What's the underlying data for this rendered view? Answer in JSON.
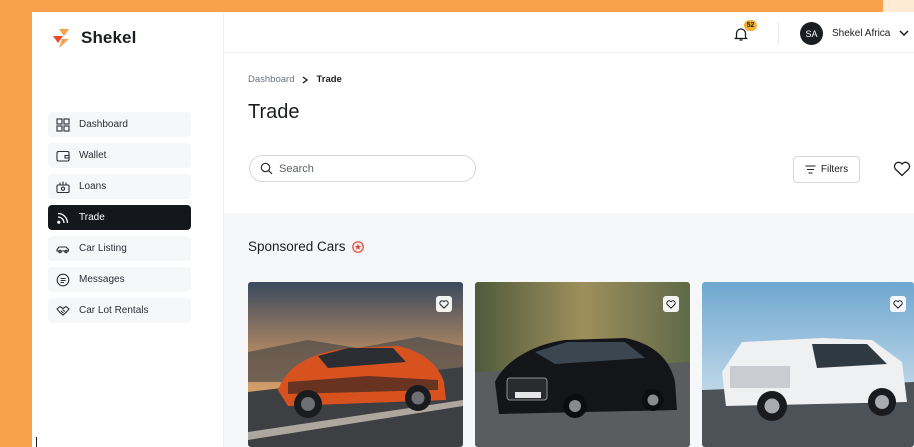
{
  "app": {
    "name": "Shekel"
  },
  "sidebar": {
    "items": [
      {
        "label": "Dashboard",
        "icon": "grid-icon",
        "active": false
      },
      {
        "label": "Wallet",
        "icon": "wallet-icon",
        "active": false
      },
      {
        "label": "Loans",
        "icon": "loans-icon",
        "active": false
      },
      {
        "label": "Trade",
        "icon": "rss-icon",
        "active": true
      },
      {
        "label": "Car Listing",
        "icon": "car-icon",
        "active": false
      },
      {
        "label": "Messages",
        "icon": "message-icon",
        "active": false
      },
      {
        "label": "Car Lot Rentals",
        "icon": "handshake-icon",
        "active": false
      }
    ]
  },
  "header": {
    "notifications": {
      "count": "52",
      "icon": "bell-icon"
    },
    "user": {
      "initials": "SA",
      "name": "Shekel Africa"
    }
  },
  "breadcrumb": {
    "root": "Dashboard",
    "current": "Trade"
  },
  "page": {
    "title": "Trade"
  },
  "search": {
    "placeholder": "Search",
    "value": ""
  },
  "toolbar": {
    "filters_label": "Filters"
  },
  "sponsored": {
    "title": "Sponsored Cars",
    "cars": [
      {
        "image": "orange-sedan",
        "icon": "heart-icon"
      },
      {
        "image": "black-luxury-sedan",
        "icon": "heart-icon"
      },
      {
        "image": "white-suv",
        "icon": "heart-icon"
      }
    ]
  },
  "colors": {
    "accent": "#f7a14a",
    "sidebar_active_bg": "#14171c",
    "badge": "#f2b233",
    "sponsored_badge": "#e8432f"
  }
}
